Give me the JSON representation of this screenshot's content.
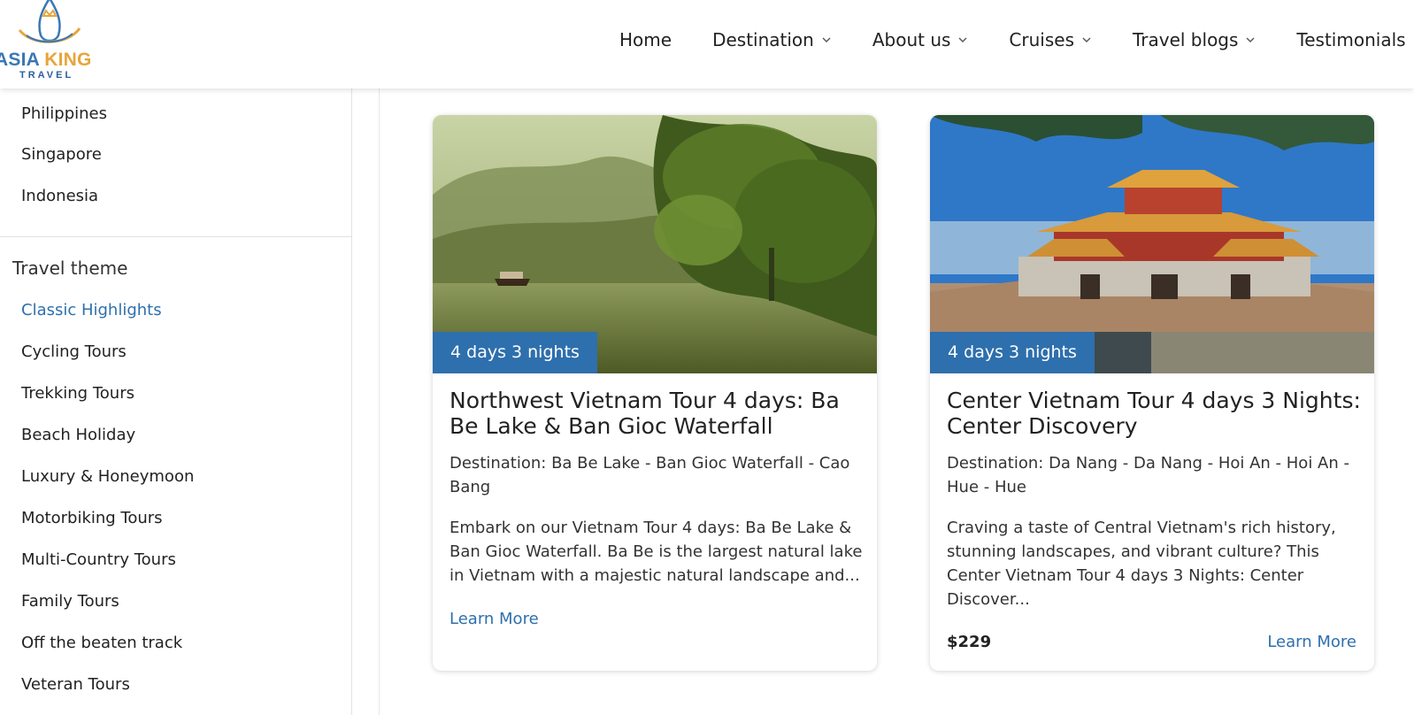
{
  "logo": {
    "name_part1": "ASIA",
    "name_part2": "KING",
    "subtitle": "TRAVEL",
    "primary_color": "#3a77b5",
    "accent_color": "#e6a63b"
  },
  "nav": {
    "items": [
      {
        "label": "Home",
        "has_dropdown": false
      },
      {
        "label": "Destination",
        "has_dropdown": true
      },
      {
        "label": "About us",
        "has_dropdown": true
      },
      {
        "label": "Cruises",
        "has_dropdown": true
      },
      {
        "label": "Travel blogs",
        "has_dropdown": true
      },
      {
        "label": "Testimonials",
        "has_dropdown": false
      }
    ]
  },
  "sidebar": {
    "destinations": [
      "Philippines",
      "Singapore",
      "Indonesia"
    ],
    "theme_heading": "Travel theme",
    "themes": [
      "Classic Highlights",
      "Cycling Tours",
      "Trekking Tours",
      "Beach Holiday",
      "Luxury & Honeymoon",
      "Motorbiking Tours",
      "Multi-Country Tours",
      "Family Tours",
      "Off the beaten track",
      "Veteran Tours"
    ],
    "active_theme": "Classic Highlights",
    "link_color": "#2e70ad"
  },
  "cards": [
    {
      "duration": "4 days 3 nights",
      "title": "Northwest Vietnam Tour 4 days: Ba Be Lake & Ban Gioc Waterfall",
      "destination": "Destination: Ba Be Lake - Ban Gioc Waterfall - Cao Bang",
      "description": "Embark on our Vietnam Tour 4 days: Ba Be Lake & Ban Gioc Waterfall. Ba Be is the largest natural lake in Vietnam with a majestic natural landscape and...",
      "price": "",
      "cta": "Learn More",
      "image": "lake-with-boat-and-trees"
    },
    {
      "duration": "4 days 3 nights",
      "title": "Center Vietnam Tour 4 days 3 Nights: Center Discovery",
      "destination": "Destination: Da Nang - Da Nang - Hoi An - Hoi An - Hue - Hue",
      "description": "Craving a taste of Central Vietnam's rich history, stunning landscapes, and vibrant culture? This Center Vietnam Tour 4 days 3 Nights: Center Discover...",
      "price": "$229",
      "cta": "Learn More",
      "image": "hue-imperial-citadel-gate"
    }
  ],
  "badge_color": "#2e6fad"
}
